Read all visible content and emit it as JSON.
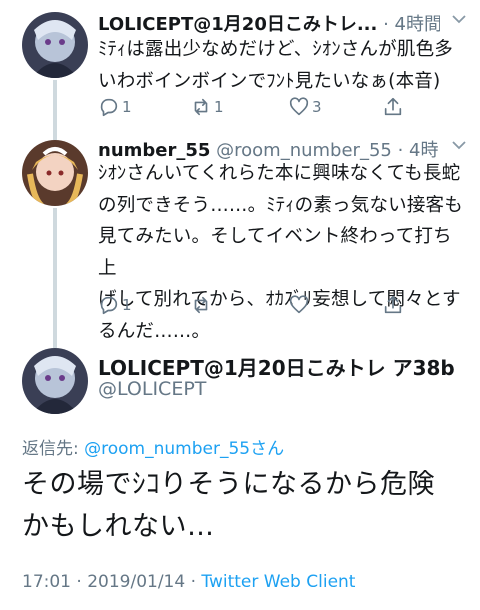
{
  "tweets": [
    {
      "display_name": "LOLICEPT@1月20日こみトレ...",
      "meta_suffix": "· 4時間",
      "text_lines": [
        "ﾐﾃｨは露出少なめだけど、ｼｵﾝさんが肌色多",
        "いわボインボインでﾌﾝﾄ見たいなぁ(本音)"
      ],
      "reply_count": "1",
      "retweet_count": "1",
      "like_count": "3"
    },
    {
      "display_name": "number_55",
      "handle": "@room_number_55",
      "meta_suffix": "· 4時間",
      "text_lines": [
        "ｼｵﾝさんいてくれらた本に興味なくても長蛇",
        "の列できそう……。ﾐﾃｨの素っ気ない接客も",
        "見てみたい。そしてイベント終わって打ち上",
        "げして別れてから、ｵｶｽﾞﾘ妄想して悶々とす",
        "るんだ……。"
      ],
      "reply_count": "1",
      "retweet_count": "",
      "like_count": ""
    }
  ],
  "main_tweet": {
    "display_name": "LOLICEPT@1月20日こみトレ ア38b",
    "handle": "@LOLICEPT",
    "reply_prefix": "返信先: ",
    "reply_target": "@room_number_55",
    "reply_suffix": "さん",
    "text_lines": [
      "その場でｼｺりそうになるから危険",
      "かもしれない…"
    ],
    "time": "17:01 · 2019/01/14 · ",
    "client": "Twitter Web Client"
  },
  "colors": {
    "link": "#1da1f2",
    "muted": "#657786",
    "thread_line": "#cfd9de"
  },
  "icons": [
    "reply-icon",
    "retweet-icon",
    "like-icon",
    "share-icon",
    "chevron-down-icon"
  ]
}
